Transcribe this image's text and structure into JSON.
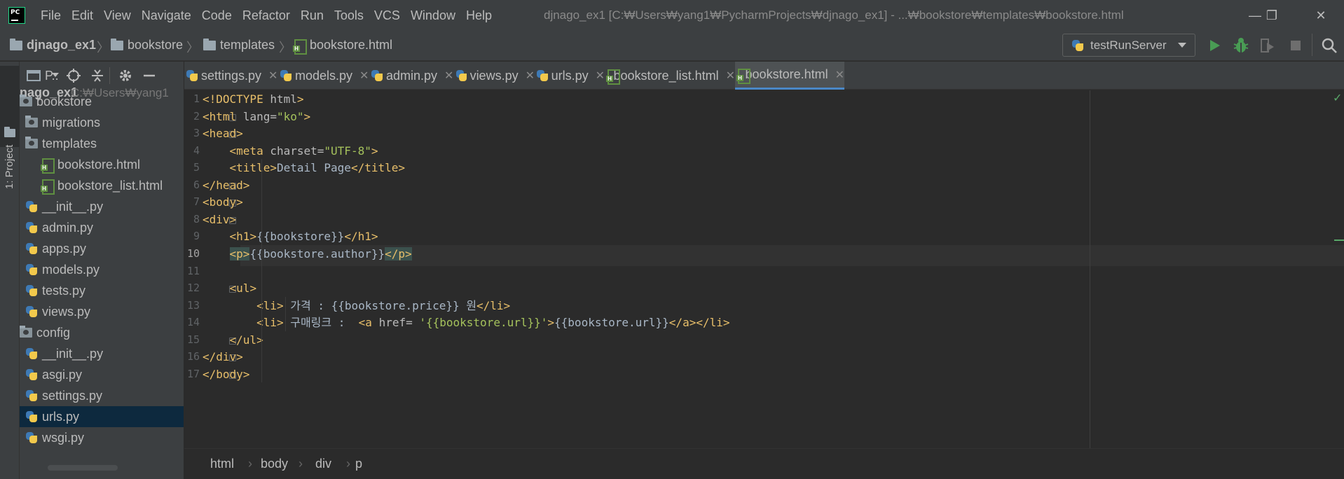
{
  "menubar": {
    "logo_text": "PC",
    "items": [
      "File",
      "Edit",
      "View",
      "Navigate",
      "Code",
      "Refactor",
      "Run",
      "Tools",
      "VCS",
      "Window",
      "Help"
    ],
    "title": "djnago_ex1 [C:₩Users₩yang1₩PycharmProjects₩djnago_ex1] - ...₩bookstore₩templates₩bookstore.html",
    "minimize": "—",
    "restore": "❐",
    "close": "✕"
  },
  "navbar": {
    "crumbs": [
      "djnago_ex1",
      "bookstore",
      "templates",
      "bookstore.html"
    ],
    "separator": "〉",
    "run_config": "testRunServer"
  },
  "left_stripe": {
    "project_label": "1: Project"
  },
  "project_panel": {
    "view_label": "P..",
    "root_name": "nago_ex1",
    "root_path": "C:₩Users₩yang1",
    "tree": [
      {
        "label": "bookstore",
        "indent": 0,
        "icon": "folder-icon"
      },
      {
        "label": "migrations",
        "indent": 1,
        "icon": "folder-icon"
      },
      {
        "label": "templates",
        "indent": 1,
        "icon": "folder-icon"
      },
      {
        "label": "bookstore.html",
        "indent": 2,
        "icon": "html-file-icon"
      },
      {
        "label": "bookstore_list.html",
        "indent": 2,
        "icon": "html-file-icon"
      },
      {
        "label": "__init__.py",
        "indent": 1,
        "icon": "python-file-icon"
      },
      {
        "label": "admin.py",
        "indent": 1,
        "icon": "python-file-icon"
      },
      {
        "label": "apps.py",
        "indent": 1,
        "icon": "python-file-icon"
      },
      {
        "label": "models.py",
        "indent": 1,
        "icon": "python-file-icon"
      },
      {
        "label": "tests.py",
        "indent": 1,
        "icon": "python-file-icon"
      },
      {
        "label": "views.py",
        "indent": 1,
        "icon": "python-file-icon"
      },
      {
        "label": "config",
        "indent": 0,
        "icon": "folder-icon"
      },
      {
        "label": "__init__.py",
        "indent": 1,
        "icon": "python-file-icon"
      },
      {
        "label": "asgi.py",
        "indent": 1,
        "icon": "python-file-icon"
      },
      {
        "label": "settings.py",
        "indent": 1,
        "icon": "python-file-icon"
      },
      {
        "label": "urls.py",
        "indent": 1,
        "icon": "python-file-icon",
        "selected": true
      },
      {
        "label": "wsgi.py",
        "indent": 1,
        "icon": "python-file-icon"
      }
    ]
  },
  "tabs": [
    {
      "label": "settings.py",
      "icon": "python-file-icon",
      "active": false
    },
    {
      "label": "models.py",
      "icon": "python-file-icon",
      "active": false
    },
    {
      "label": "admin.py",
      "icon": "python-file-icon",
      "active": false
    },
    {
      "label": "views.py",
      "icon": "python-file-icon",
      "active": false
    },
    {
      "label": "urls.py",
      "icon": "python-file-icon",
      "active": false
    },
    {
      "label": "bookstore_list.html",
      "icon": "html-file-icon",
      "active": false
    },
    {
      "label": "bookstore.html",
      "icon": "html-file-icon",
      "active": true
    }
  ],
  "tab_close": "✕",
  "editor": {
    "current_line": 10,
    "lines": [
      {
        "n": "1",
        "code": "<!DOCTYPE html>"
      },
      {
        "n": "2",
        "code": "<html lang=\"ko\">"
      },
      {
        "n": "3",
        "code": "<head>"
      },
      {
        "n": "4",
        "code": "    <meta charset=\"UTF-8\">"
      },
      {
        "n": "5",
        "code": "    <title>Detail Page</title>"
      },
      {
        "n": "6",
        "code": "</head>"
      },
      {
        "n": "7",
        "code": "<body>"
      },
      {
        "n": "8",
        "code": "<div>"
      },
      {
        "n": "9",
        "code": "    <h1>{{bookstore}}</h1>"
      },
      {
        "n": "10",
        "code": "    <p>{{bookstore.author}}</p>"
      },
      {
        "n": "11",
        "code": ""
      },
      {
        "n": "12",
        "code": "    <ul>"
      },
      {
        "n": "13",
        "code": "        <li> 가격 : {{bookstore.price}} 원</li>"
      },
      {
        "n": "14",
        "code": "        <li> 구매링크 :  <a href= '{{bookstore.url}}'>{{bookstore.url}}</a></li>"
      },
      {
        "n": "15",
        "code": "    </ul>"
      },
      {
        "n": "16",
        "code": "</div>"
      },
      {
        "n": "17",
        "code": "</body>"
      }
    ]
  },
  "code_breadcrumb": [
    "html",
    "body",
    "div",
    "p"
  ],
  "colors": {
    "tag": "#e8bf6a",
    "attr_value": "#a5c25c",
    "text": "#a9b7c6",
    "selection": "#0d293e",
    "active_tab_underline": "#4a88c7"
  }
}
